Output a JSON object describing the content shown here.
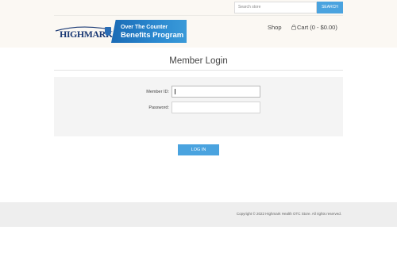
{
  "header": {
    "search": {
      "placeholder": "Search store",
      "button_label": "SEARCH"
    },
    "logo": {
      "brand": "HIGHMARK",
      "line1": "Over The Counter",
      "line2": "Benefits Program"
    },
    "nav": {
      "shop": "Shop",
      "cart": "Cart (0 - $0.00)"
    }
  },
  "main": {
    "title": "Member Login",
    "member_id_label": "Member ID:",
    "password_label": "Password:",
    "member_id_value": "",
    "password_value": "",
    "login_button": "LOG IN"
  },
  "footer": {
    "copyright": "Copyright © 2022 Highmark Health OTC Store. All rights reserved."
  },
  "colors": {
    "accent": "#4aa3df",
    "brand_navy": "#1b3a75",
    "banner_blue": "#2b89d0"
  }
}
